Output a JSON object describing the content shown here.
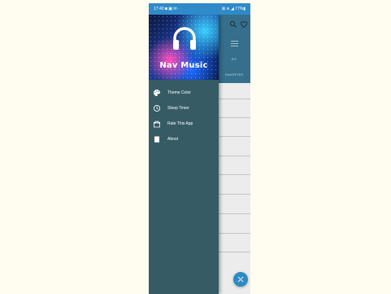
{
  "status_bar": {
    "time_icons": "17:40 ◙ ▣ ✉ ·",
    "right_icons": "⊠ ≋ ◢ 77%▮"
  },
  "app": {
    "tab_1": "RIT",
    "tab_2": "FAVORITES"
  },
  "drawer": {
    "app_title": "Nav Music",
    "items": [
      {
        "label": "Theme Color",
        "icon": "palette-icon"
      },
      {
        "label": "Sleep Timer",
        "icon": "clock-icon"
      },
      {
        "label": "Rate This App",
        "icon": "gift-icon"
      },
      {
        "label": "About",
        "icon": "book-icon"
      }
    ]
  },
  "colors": {
    "status_bar": "#2e8ac9",
    "drawer_bg": "#365b65",
    "app_header": "#356f8b",
    "fab": "#2f8ac4"
  }
}
